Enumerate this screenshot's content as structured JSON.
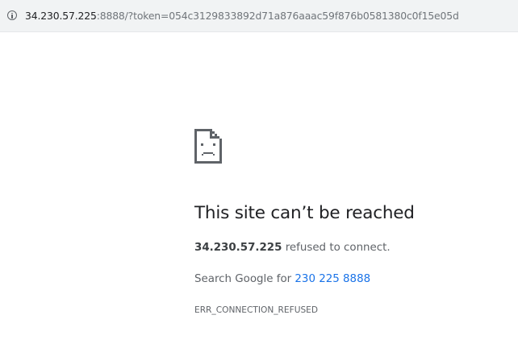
{
  "omnibox": {
    "icon": "info-icon",
    "url_host": "34.230.57.225",
    "url_rest": ":8888/?token=054c3129833892d71a876aaac59f876b0581380c0f15e05d"
  },
  "error": {
    "icon": "sad-page-icon",
    "title": "This site can’t be reached",
    "host": "34.230.57.225",
    "refused_text": " refused to connect.",
    "search_prefix": "Search Google for ",
    "search_link": "230 225 8888",
    "code": "ERR_CONNECTION_REFUSED"
  }
}
